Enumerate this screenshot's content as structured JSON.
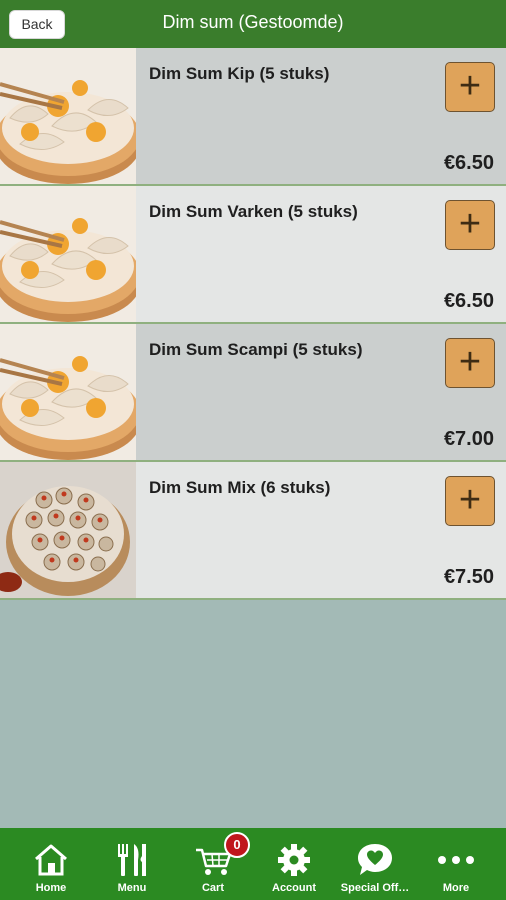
{
  "header": {
    "back_label": "Back",
    "title": "Dim sum (Gestoomde)"
  },
  "items": [
    {
      "name": "Dim Sum Kip (5 stuks)",
      "price": "€6.50",
      "add_icon": "plus-icon",
      "image": "dumplings-steamer-photo"
    },
    {
      "name": "Dim Sum Varken (5 stuks)",
      "price": "€6.50",
      "add_icon": "plus-icon",
      "image": "dumplings-steamer-photo"
    },
    {
      "name": "Dim Sum Scampi (5 stuks)",
      "price": "€7.00",
      "add_icon": "plus-icon",
      "image": "dumplings-steamer-photo"
    },
    {
      "name": "Dim Sum Mix (6 stuks)",
      "price": "€7.50",
      "add_icon": "plus-icon",
      "image": "siu-mai-steamer-photo"
    }
  ],
  "tabbar": {
    "tabs": [
      {
        "label": "Home",
        "icon": "home-icon"
      },
      {
        "label": "Menu",
        "icon": "fork-knife-icon"
      },
      {
        "label": "Cart",
        "icon": "cart-icon"
      },
      {
        "label": "Account",
        "icon": "gear-icon"
      },
      {
        "label": "Special Off…",
        "icon": "heart-chat-icon"
      },
      {
        "label": "More",
        "icon": "more-dots-icon"
      }
    ],
    "cart_count": "0"
  },
  "colors": {
    "header_bg": "#3a7d2c",
    "tabbar_bg": "#2b8a22",
    "add_button": "#dfa35a",
    "badge": "#c0161d",
    "background": "#a3bab6"
  }
}
